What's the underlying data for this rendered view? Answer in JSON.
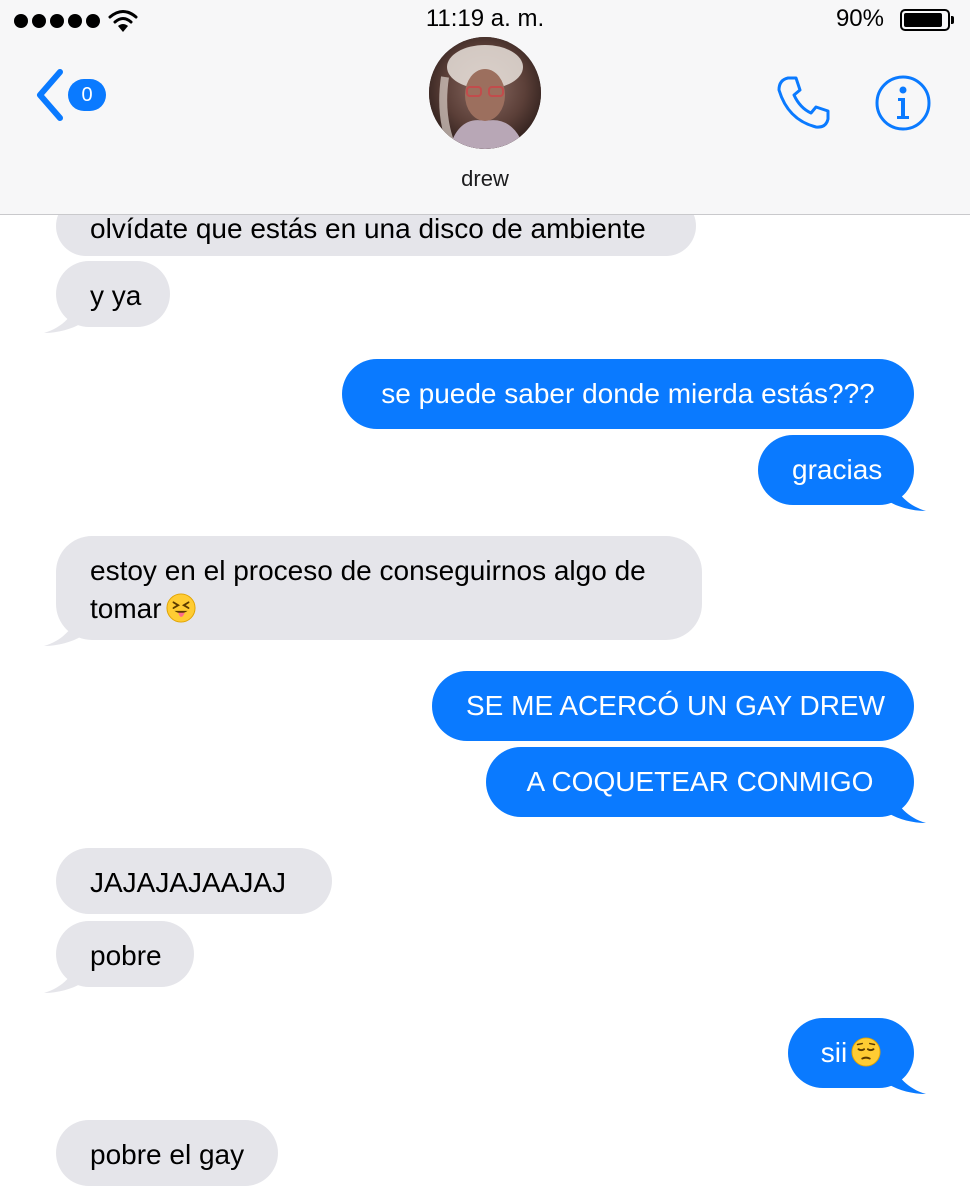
{
  "status": {
    "time": "11:19 a. m.",
    "battery": "90%",
    "battery_level": 0.9
  },
  "nav": {
    "unread_count": "0",
    "contact_name": "drew"
  },
  "colors": {
    "accent": "#0a7aff",
    "incoming_bubble": "#e5e5ea",
    "outgoing_bubble": "#0a7aff"
  },
  "icons": {
    "back": "chevron-left-icon",
    "call": "phone-icon",
    "info": "info-icon"
  },
  "messages": [
    {
      "direction": "incoming",
      "text": "olvídate que estás en una disco de ambiente"
    },
    {
      "direction": "incoming",
      "text": "y ya"
    },
    {
      "direction": "outgoing",
      "text": "se puede saber donde mierda estás???"
    },
    {
      "direction": "outgoing",
      "text": "gracias"
    },
    {
      "direction": "incoming",
      "text": "estoy en el proceso de conseguirnos algo de",
      "text_line2": "tomar",
      "emoji": "squinting-tongue-emoji"
    },
    {
      "direction": "outgoing",
      "text": "SE ME ACERCÓ UN GAY DREW"
    },
    {
      "direction": "outgoing",
      "text": "A COQUETEAR CONMIGO"
    },
    {
      "direction": "incoming",
      "text": "JAJAJAJAAJAJ"
    },
    {
      "direction": "incoming",
      "text": "pobre"
    },
    {
      "direction": "outgoing",
      "text": "sii",
      "emoji": "pensive-emoji"
    },
    {
      "direction": "incoming",
      "text": "pobre el gay"
    }
  ]
}
